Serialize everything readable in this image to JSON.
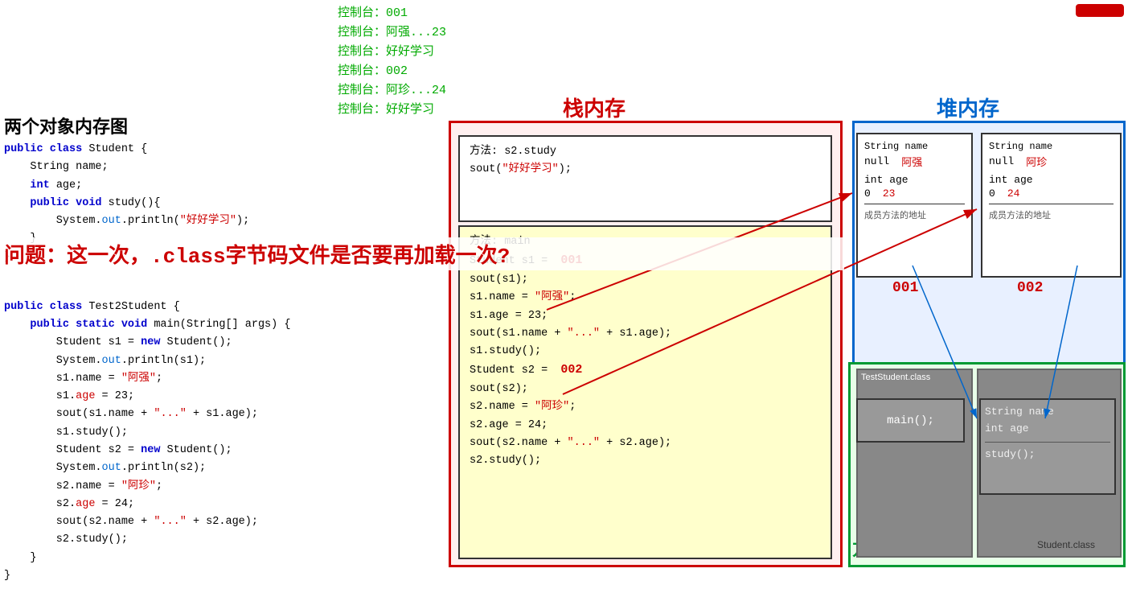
{
  "console": {
    "lines": [
      "控制台：001",
      "控制台：阿强...23",
      "控制台：好好学习",
      "控制台：002",
      "控制台：阿珍...24",
      "控制台：好好学习"
    ]
  },
  "titles": {
    "left_section": "两个对象内存图",
    "stack": "栈内存",
    "heap": "堆内存",
    "method_area": "方法区",
    "question": "问题：这一次，.class字节码文件是否要再加载一次?"
  },
  "stack": {
    "s2_study_label": "方法: s2.study",
    "s2_study_line": "sout(\"好好学习\");",
    "main_label": "方法: main",
    "main_lines": [
      "Student s1 =  001",
      "sout(s1);",
      "s1.name = \"阿强\";",
      "s1.age = 23;",
      "sout(s1.name + \"...\" + s1.age);",
      "s1.study();",
      "Student s2 =  002",
      "sout(s2);",
      "s2.name = \"阿珍\";",
      "s2.age = 24;",
      "sout(s2.name + \"...\" + s2.age);",
      "s2.study();"
    ]
  },
  "heap": {
    "obj1": {
      "label": "001",
      "string_name_label": "String name",
      "null_val": "null",
      "name_val": "阿强",
      "int_age_label": "int age",
      "age_null": "0",
      "age_val": "23",
      "member_method": "成员方法的地址"
    },
    "obj2": {
      "label": "002",
      "string_name_label": "String name",
      "null_val": "null",
      "name_val": "阿珍",
      "int_age_label": "int age",
      "age_null": "0",
      "age_val": "24",
      "member_method": "成员方法的地址"
    }
  },
  "method_area": {
    "test_student_class": "TestStudent.class",
    "main_method": "main();",
    "student_class": "Student.class",
    "string_name": "String name",
    "int_age": "int age",
    "study_method": "study();"
  },
  "code_left": {
    "class1": [
      "public class Student {",
      "    String name;",
      "    int age;",
      "    public void study(){",
      "        System.out.println(\"好好学习\");",
      "    }",
      "}"
    ],
    "class2": [
      "public class Test2Student {",
      "    public static void main(String[] args) {",
      "        Student s1 = new Student();",
      "        System.out.println(s1);",
      "        s1.name = \"阿强\";",
      "        s1.age = 23;",
      "        sout(s1.name + \"...\" + s1.age);",
      "        s1.study();",
      "        Student s2 = new Student();",
      "        System.out.println(s2);",
      "        s2.name = \"阿珍\";",
      "        s2.age = 24;",
      "        sout(s2.name + \"...\" + s2.age);",
      "        s2.study();",
      "    }",
      "}"
    ]
  }
}
